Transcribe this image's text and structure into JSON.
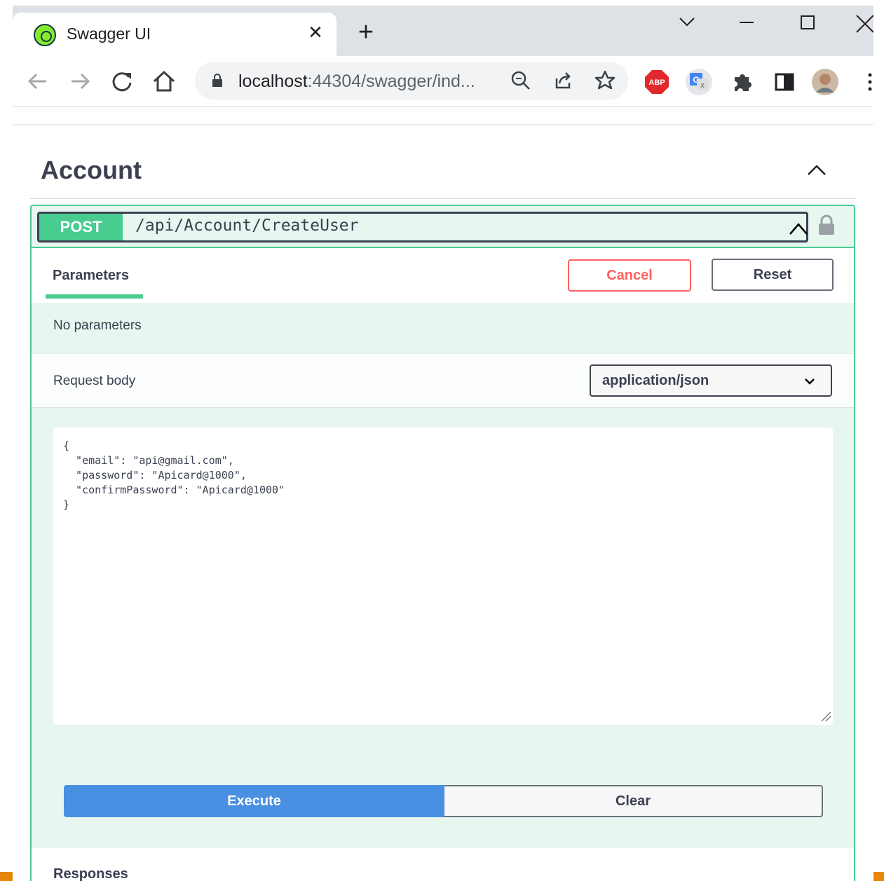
{
  "browser": {
    "tab": {
      "title": "Swagger UI",
      "favicon": "swagger-favicon-icon"
    },
    "url": {
      "host": "localhost",
      "rest": ":44304/swagger/ind..."
    },
    "accent_color": "#e8860b"
  },
  "swagger": {
    "tag": {
      "title": "Account"
    },
    "operation": {
      "method": "POST",
      "path": "/api/Account/CreateUser",
      "method_color": "#49cc90"
    },
    "parameters": {
      "tab_label": "Parameters",
      "cancel_label": "Cancel",
      "reset_label": "Reset",
      "empty_text": "No parameters"
    },
    "request_body": {
      "label": "Request body",
      "content_type": "application/json",
      "code": "{\n  \"email\": \"api@gmail.com\",\n  \"password\": \"Apicard@1000\",\n  \"confirmPassword\": \"Apicard@1000\"\n}"
    },
    "actions": {
      "execute_label": "Execute",
      "clear_label": "Clear",
      "execute_color": "#4990e2"
    },
    "responses": {
      "label": "Responses"
    }
  }
}
